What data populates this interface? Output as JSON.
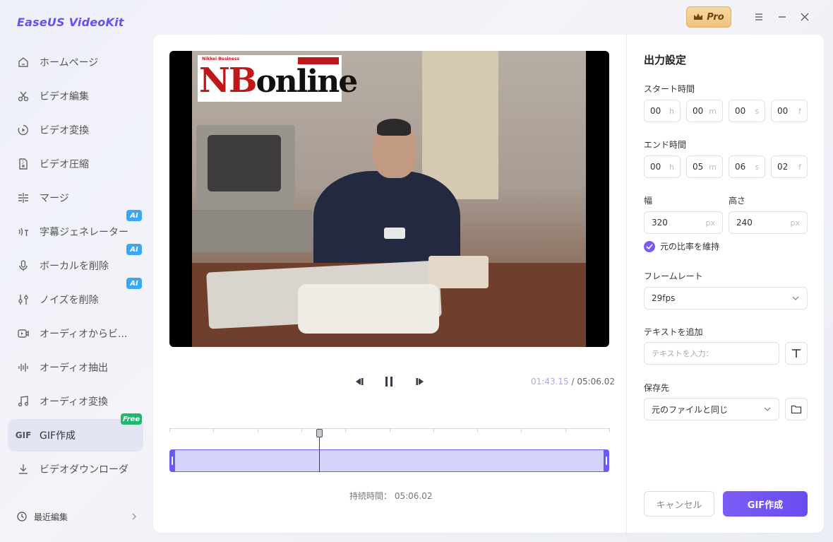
{
  "app": {
    "title": "EaseUS VideoKit",
    "pro_label": "Pro"
  },
  "sidebar": {
    "items": [
      {
        "label": "ホームページ",
        "icon": "home-icon"
      },
      {
        "label": "ビデオ編集",
        "icon": "scissors-icon"
      },
      {
        "label": "ビデオ変換",
        "icon": "convert-icon"
      },
      {
        "label": "ビデオ圧縮",
        "icon": "compress-icon"
      },
      {
        "label": "マージ",
        "icon": "merge-icon"
      },
      {
        "label": "字幕ジェネレーター",
        "icon": "subtitle-icon",
        "badge": "AI"
      },
      {
        "label": "ボーカルを削除",
        "icon": "microphone-icon",
        "badge": "AI"
      },
      {
        "label": "ノイズを削除",
        "icon": "sliders-icon",
        "badge": "AI"
      },
      {
        "label": "オーディオからビ...",
        "icon": "audio-video-icon"
      },
      {
        "label": "オーディオ抽出",
        "icon": "waveform-icon"
      },
      {
        "label": "オーディオ変換",
        "icon": "music-note-icon"
      },
      {
        "label": "GIF作成",
        "icon": "gif-icon",
        "icon_text": "GIF",
        "badge": "Free",
        "active": true
      },
      {
        "label": "ビデオダウンローダ",
        "icon": "download-icon"
      }
    ],
    "recent": "最近編集"
  },
  "video": {
    "overlay_small": "Nikkei Business",
    "overlay_logo_n": "NB",
    "overlay_logo_rest": "online"
  },
  "player": {
    "current_time": "01:43.15",
    "separator": " / ",
    "total_time": "05:06.02",
    "playhead_fraction": 0.34,
    "duration_label": "持続時間：",
    "duration_value": "05:06.02"
  },
  "settings": {
    "title": "出力設定",
    "start_label": "スタート時間",
    "start": [
      {
        "value": "00",
        "unit": "h"
      },
      {
        "value": "00",
        "unit": "m"
      },
      {
        "value": "00",
        "unit": "s"
      },
      {
        "value": "00",
        "unit": "f"
      }
    ],
    "end_label": "エンド時間",
    "end": [
      {
        "value": "00",
        "unit": "h"
      },
      {
        "value": "05",
        "unit": "m"
      },
      {
        "value": "06",
        "unit": "s"
      },
      {
        "value": "02",
        "unit": "f"
      }
    ],
    "width_label": "幅",
    "width_value": "320",
    "height_label": "高さ",
    "height_value": "240",
    "px_unit": "px",
    "keep_ratio": "元の比率を維持",
    "keep_ratio_checked": true,
    "framerate_label": "フレームレート",
    "framerate_value": "29fps",
    "addtext_label": "テキストを追加",
    "addtext_placeholder": "テキストを入力：",
    "savepath_label": "保存先",
    "savepath_value": "元のファイルと同じ",
    "cancel": "キャンセル",
    "create": "GIF作成"
  },
  "colors": {
    "accent": "#6a4cf0",
    "ai_badge": "#3aa6f5",
    "free_badge": "#1eb871"
  }
}
